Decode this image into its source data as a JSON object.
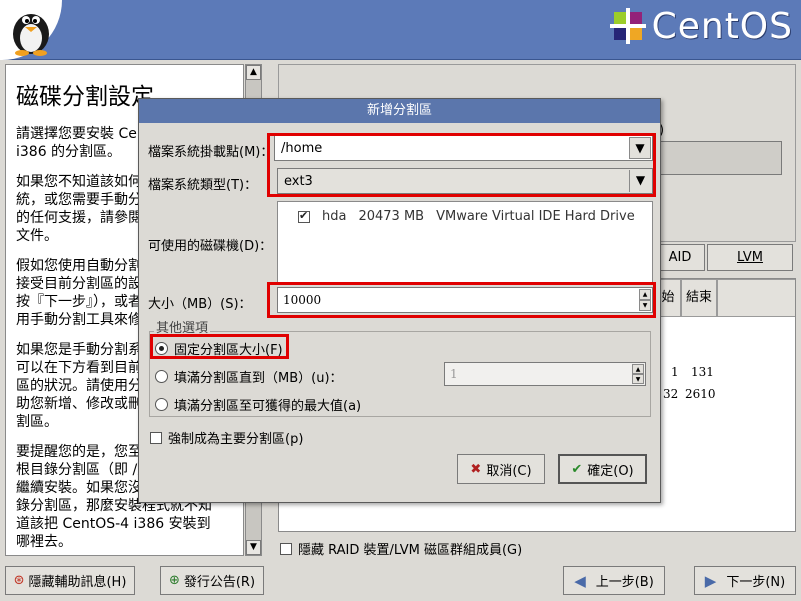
{
  "header": {
    "logo_text": "CentOS"
  },
  "help": {
    "title": "磁碟分割設定",
    "paragraphs": [
      "請選擇您要安裝 CentOS-4\ni386 的分割區。",
      "如果您不知道該如何分割系\n統，或您需要手動分割，但需\n的任何支援，請參閱產品說明\n文件。",
      "假如您使用自動分割，您可\n接受目前分割區的設定（或\n按『下一步』），或者使\n用手動分割工具來修改設定。",
      "如果您是手動分割系統，您\n可以在下方看到目前硬碟和分割\n區的狀況。請使用分割工具來協\n助您新增、修改或刪除\n割區。",
      "要提醒您的是，您至少需要一個\n根目錄分割區（即 /）才能\n繼續安裝。如果您沒有建立根目\n錄分割區，那麼安裝程式就不知\n道該把 CentOS-4 i386 安裝到\n哪裡去。"
    ]
  },
  "background": {
    "paren": ")",
    "raid_button": "AID",
    "lvm_button": "LVM",
    "table_headers": [
      "始",
      "結束"
    ],
    "table_rows": [
      [
        "1",
        "131"
      ],
      [
        "32",
        "2610"
      ]
    ],
    "hide_raid_label": "隱藏 RAID 裝置/LVM 磁區群組成員(G)"
  },
  "bottom": {
    "hide_help": "隱藏輔助訊息(H)",
    "release_notes": "發行公告(R)",
    "back": "上一步(B)",
    "next": "下一步(N)"
  },
  "dialog": {
    "title": "新增分割區",
    "mount_label": "檔案系統掛載點(M)：",
    "mount_value": "/home",
    "fstype_label": "檔案系統類型(T)：",
    "fstype_value": "ext3",
    "drives_label": "可使用的磁碟機(D)：",
    "drive": {
      "name": "hda",
      "size": "20473 MB",
      "model": "VMware Virtual IDE Hard Drive"
    },
    "size_label": "大小（MB）(S)：",
    "size_value": "10000",
    "other_title": "其他選項",
    "fixed_label": "固定分割區大小(F)",
    "fill_to_label": "填滿分割區直到（MB）(u)：",
    "fill_to_value": "1",
    "fill_max_label": "填滿分割區至可獲得的最大值(a)",
    "primary_label": "強制成為主要分割區(p)",
    "cancel": "取消(C)",
    "ok": "確定(O)"
  },
  "colors": {
    "titlebar": "#5b76ac",
    "highlight": "#e00000",
    "header": "#5c7ab8"
  }
}
